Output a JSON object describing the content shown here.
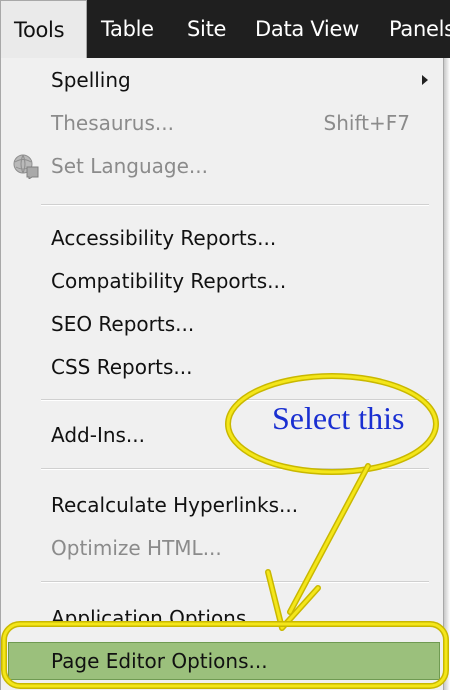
{
  "menubar": {
    "items": [
      {
        "label": "Tools",
        "active": true
      },
      {
        "label": "Table"
      },
      {
        "label": "Site"
      },
      {
        "label": "Data View"
      },
      {
        "label": "Panels"
      }
    ]
  },
  "menu": {
    "items": [
      {
        "label": "Spelling",
        "submenu": true
      },
      {
        "label": "Thesaurus...",
        "shortcut": "Shift+F7",
        "disabled": true
      },
      {
        "label": "Set Language...",
        "disabled": true,
        "icon": "set-language-icon"
      },
      {
        "label": "Accessibility Reports..."
      },
      {
        "label": "Compatibility Reports..."
      },
      {
        "label": "SEO Reports..."
      },
      {
        "label": "CSS Reports..."
      },
      {
        "label": "Add-Ins..."
      },
      {
        "label": "Recalculate Hyperlinks..."
      },
      {
        "label": "Optimize HTML...",
        "disabled": true
      },
      {
        "label": "Application Options..."
      },
      {
        "label": "Page Editor Options...",
        "highlighted": true
      }
    ]
  },
  "annotation": {
    "text": "Select this",
    "color": "#1a2fd1",
    "ring_color": "#f4e61a"
  },
  "colors": {
    "menubar_bg": "#1f1f1f",
    "menu_bg": "#f0f0f0",
    "highlight_bg": "#9bc07c",
    "disabled_text": "#8b8b8b"
  }
}
